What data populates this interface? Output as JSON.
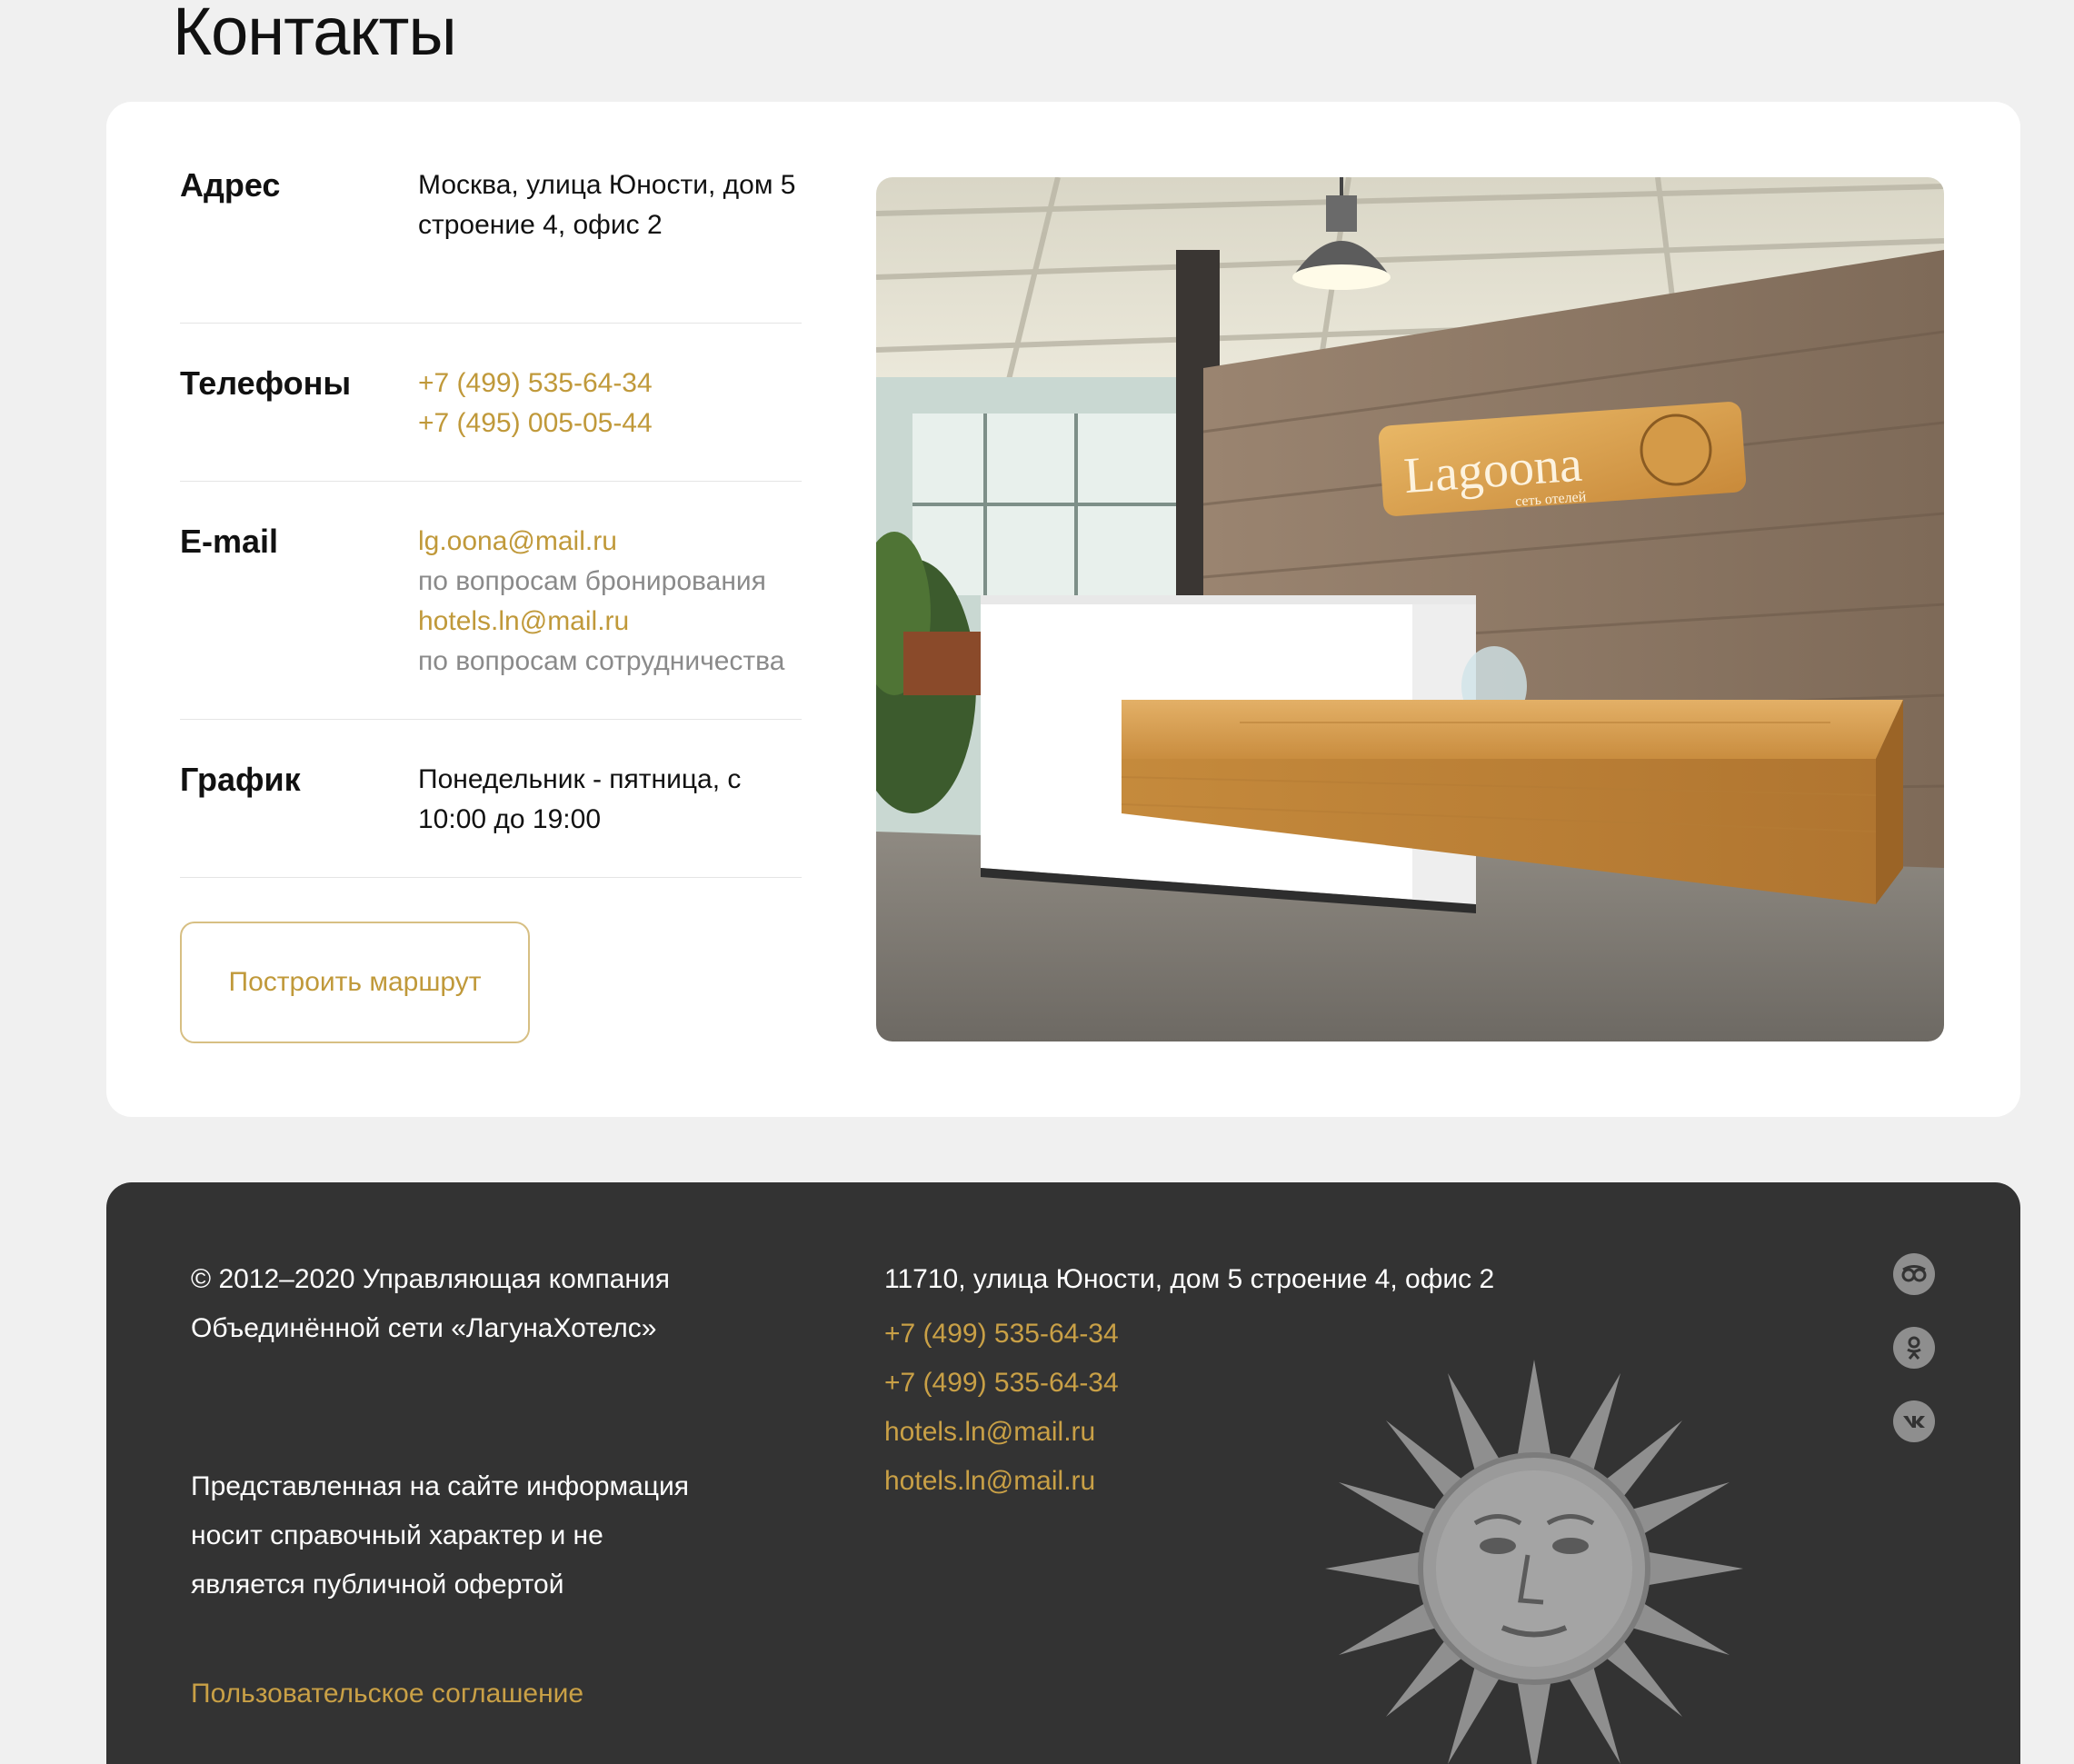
{
  "page": {
    "title": "Контакты"
  },
  "contacts": {
    "address": {
      "label": "Адрес",
      "lines": [
        "Москва, улица Юности, дом 5",
        "строение 4, офис 2"
      ]
    },
    "phones": {
      "label": "Телефоны",
      "items": [
        "+7 (499) 535-64-34",
        "+7 (495) 005-05-44"
      ]
    },
    "email": {
      "label": "E-mail",
      "items": [
        {
          "address": "lg.oona@mail.ru",
          "note": "по вопросам бронирования"
        },
        {
          "address": "hotels.ln@mail.ru",
          "note": "по вопросам сотрудничества"
        }
      ]
    },
    "schedule": {
      "label": "График",
      "lines": [
        "Понедельник - пятница, с",
        "10:00 до 19:00"
      ]
    },
    "route_button": "Построить маршрут",
    "photo": {
      "sign_text": "Lagoona",
      "sign_sub": "сеть отелей"
    }
  },
  "footer": {
    "copyright": [
      "© 2012–2020 Управляющая компания",
      "Объединённой сети «ЛагунаХотелс»"
    ],
    "disclaimer": [
      "Представленная на сайте информация",
      "носит справочный характер и не",
      "является публичной офертой"
    ],
    "agreement_link": "Пользовательское соглашение",
    "address": "11710, улица Юности, дом 5 строение 4, офис 2",
    "phones": [
      "+7 (499) 535-64-34",
      "+7 (499) 535-64-34"
    ],
    "emails": [
      "hotels.ln@mail.ru",
      "hotels.ln@mail.ru"
    ],
    "social_icons": [
      "tripadvisor-icon",
      "odnoklassniki-icon",
      "vk-icon"
    ]
  },
  "colors": {
    "accent": "#c0993a",
    "footer_bg": "#333333",
    "page_bg": "#f0f0f0"
  }
}
